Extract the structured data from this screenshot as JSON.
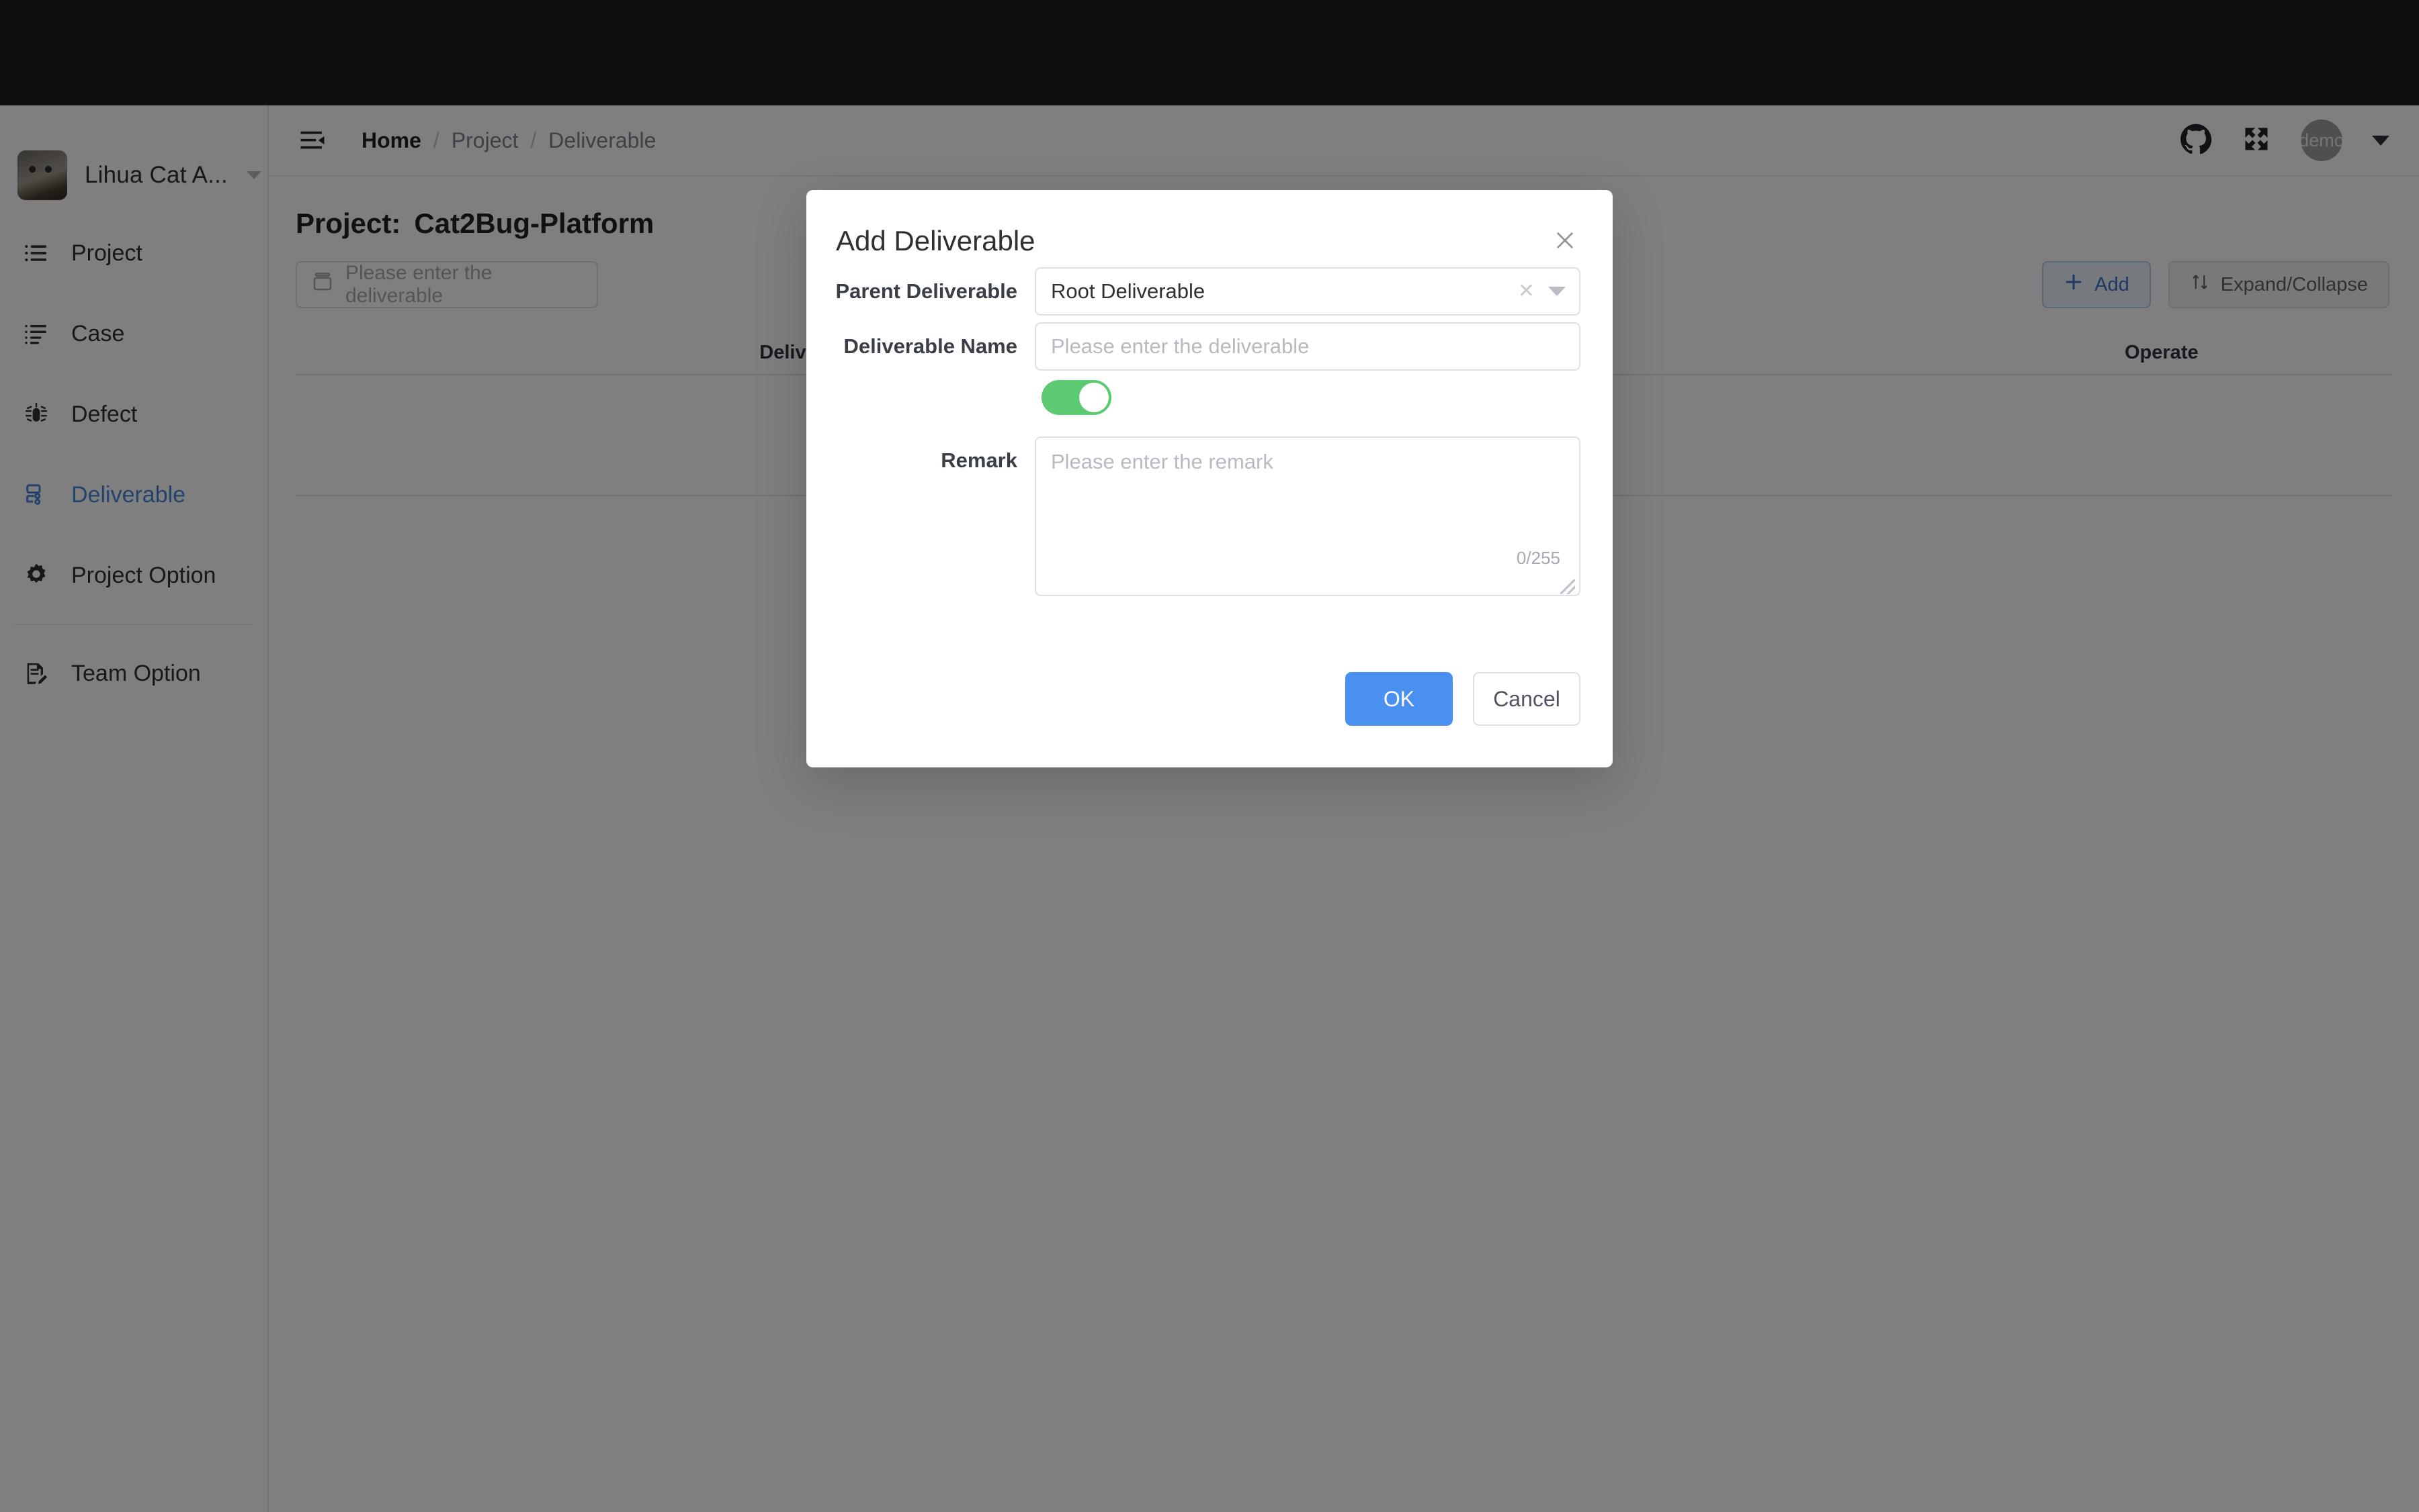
{
  "sidebar": {
    "workspace": {
      "name": "Lihua Cat A...",
      "avatar_icon": "cat-photo-avatar",
      "chevron_icon": "chevron-down-icon"
    },
    "items": [
      {
        "label": "Project",
        "icon": "list-icon",
        "active": false
      },
      {
        "label": "Case",
        "icon": "case-list-icon",
        "active": false
      },
      {
        "label": "Defect",
        "icon": "bug-icon",
        "active": false
      },
      {
        "label": "Deliverable",
        "icon": "deliverable-icon",
        "active": true
      },
      {
        "label": "Project Option",
        "icon": "gear-icon",
        "active": false
      },
      {
        "label": "Team Option",
        "icon": "document-edit-icon",
        "active": false
      }
    ]
  },
  "header": {
    "collapse_icon": "sidebar-collapse-icon",
    "breadcrumb": [
      "Home",
      "Project",
      "Deliverable"
    ],
    "separator": "/",
    "github_icon": "github-icon",
    "fullscreen_icon": "fullscreen-icon",
    "avatar_text": "demo",
    "caret_icon": "caret-down-icon"
  },
  "main": {
    "page_title_label": "Project:",
    "page_title_value": "Cat2Bug-Platform",
    "search": {
      "placeholder": "Please enter the deliverable",
      "value": "",
      "icon": "archive-box-icon"
    },
    "add_button": {
      "label": "Add",
      "icon": "plus-icon"
    },
    "expand_collapse_button": {
      "label": "Expand/Collapse",
      "icon": "sort-arrows-icon"
    },
    "table": {
      "columns": [
        "Deliverable Name",
        "Operate"
      ],
      "rows": []
    }
  },
  "modal": {
    "title": "Add Deliverable",
    "close_icon": "close-icon",
    "fields": {
      "parent_deliverable": {
        "label": "Parent Deliverable",
        "value": "Root Deliverable",
        "clear_icon": "clear-x-icon",
        "arrow_icon": "chevron-down-icon"
      },
      "deliverable_name": {
        "label": "Deliverable Name",
        "value": "",
        "placeholder": "Please enter the deliverable"
      },
      "status_toggle": {
        "state": "on",
        "color": "#5cc973"
      },
      "remark": {
        "label": "Remark",
        "value": "",
        "placeholder": "Please enter the remark",
        "counter": "0/255"
      }
    },
    "ok_label": "OK",
    "cancel_label": "Cancel"
  },
  "colors": {
    "accent_blue": "#4a90f0",
    "active_nav": "#4884d6",
    "toggle_green": "#5cc973",
    "overlay": "rgba(0,0,0,0.5)"
  }
}
